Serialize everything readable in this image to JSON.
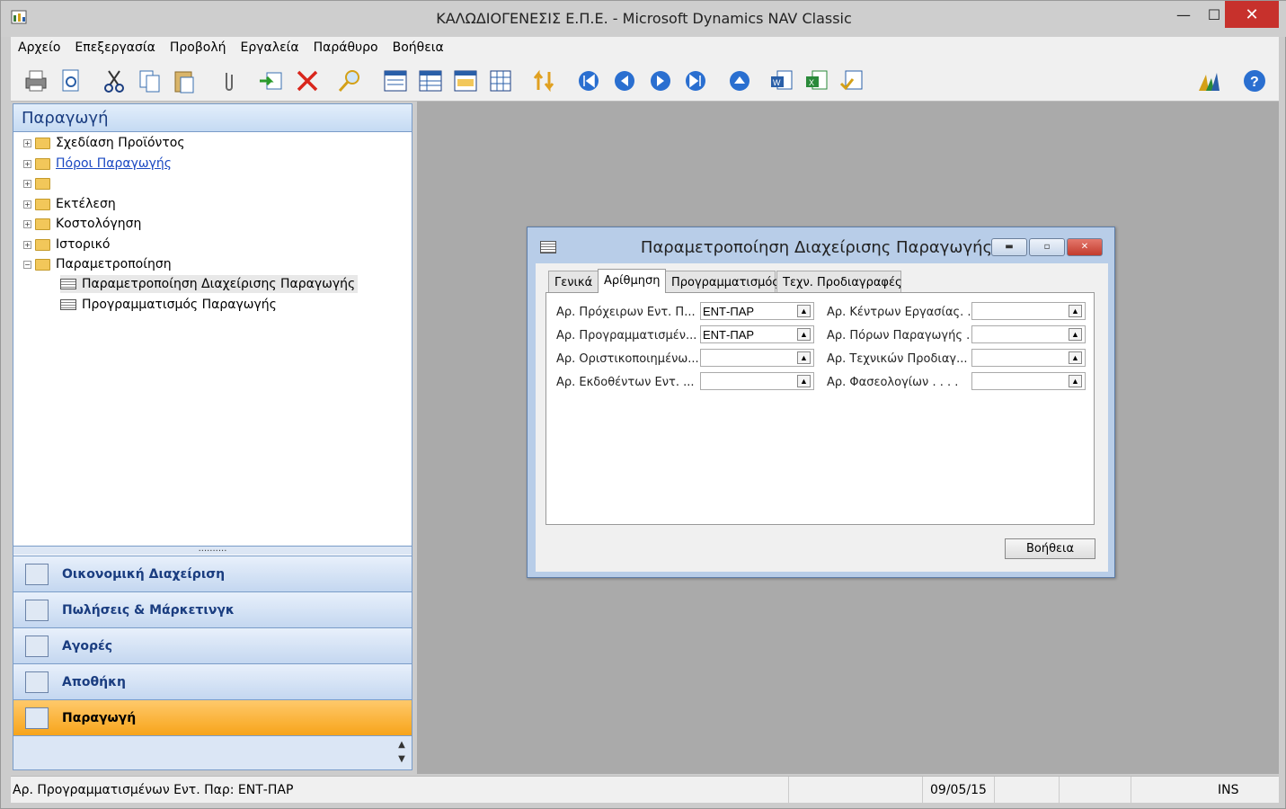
{
  "window": {
    "title": "ΚΑΛΩΔΙΟΓΕΝΕΣΙΣ Ε.Π.Ε. - Microsoft Dynamics NAV Classic",
    "min_glyph": "—",
    "max_glyph": "☐",
    "close_glyph": "✕"
  },
  "menu": [
    "Αρχείο",
    "Επεξεργασία",
    "Προβολή",
    "Εργαλεία",
    "Παράθυρο",
    "Βοήθεια"
  ],
  "toolbar": {
    "icons": [
      "print-icon",
      "print-preview-icon",
      "cut-icon",
      "copy-icon",
      "paste-icon",
      "attach-icon",
      "send-icon",
      "delete-icon",
      "find-icon",
      "form-icon",
      "list-icon",
      "card-icon",
      "table-icon",
      "sort-icon",
      "first-icon",
      "previous-icon",
      "next-icon",
      "last-icon",
      "up-icon",
      "word-icon",
      "excel-icon",
      "options-icon",
      "dynamics-icon",
      "help-icon"
    ]
  },
  "nav": {
    "header": "Παραγωγή",
    "tree": [
      {
        "label": "Σχεδίαση Προϊόντος"
      },
      {
        "label": "Πόροι Παραγωγής"
      },
      {
        "label": ""
      },
      {
        "label": "Εκτέλεση"
      },
      {
        "label": "Κοστολόγηση"
      },
      {
        "label": "Ιστορικό"
      },
      {
        "label": "Παραμετροποίηση"
      },
      {
        "label": "Παραμετροποίηση Διαχείρισης Παραγωγής"
      },
      {
        "label": "Προγραμματισμός Παραγωγής"
      }
    ],
    "splitter": "..........",
    "buttons": [
      "Οικονομική Διαχείριση",
      "Πωλήσεις & Μάρκετινγκ",
      "Αγορές",
      "Αποθήκη",
      "Παραγωγή"
    ]
  },
  "dialog": {
    "title": "Παραμετροποίηση Διαχείρισης Παραγωγής",
    "tabs": [
      "Γενικά",
      "Αρίθμηση",
      "Προγραμματισμός",
      "Τεχν. Προδιαγραφές"
    ],
    "active_tab": "Αρίθμηση",
    "left_fields": [
      {
        "label": "Αρ. Πρόχειρων Εντ. Π...",
        "value": "ΕΝΤ-ΠΑΡ"
      },
      {
        "label": "Αρ. Προγραμματισμέν...",
        "value": "ΕΝΤ-ΠΑΡ"
      },
      {
        "label": "Αρ. Οριστικοποιημένω...",
        "value": ""
      },
      {
        "label": "Αρ. Εκδοθέντων Εντ. ...",
        "value": ""
      }
    ],
    "right_fields": [
      {
        "label": "Αρ. Κέντρων Εργασίας.  .",
        "value": ""
      },
      {
        "label": "Αρ. Πόρων Παραγωγής  .",
        "value": ""
      },
      {
        "label": "Αρ. Τεχνικών Προδιαγ...",
        "value": ""
      },
      {
        "label": "Αρ. Φασεολογίων .  .  .  .",
        "value": ""
      }
    ],
    "help_button": "Βοήθεια"
  },
  "status": {
    "message": "Αρ. Προγραμματισμένων Εντ. Παρ: ΕΝΤ-ΠΑΡ",
    "date": "09/05/15",
    "mode": "INS"
  }
}
